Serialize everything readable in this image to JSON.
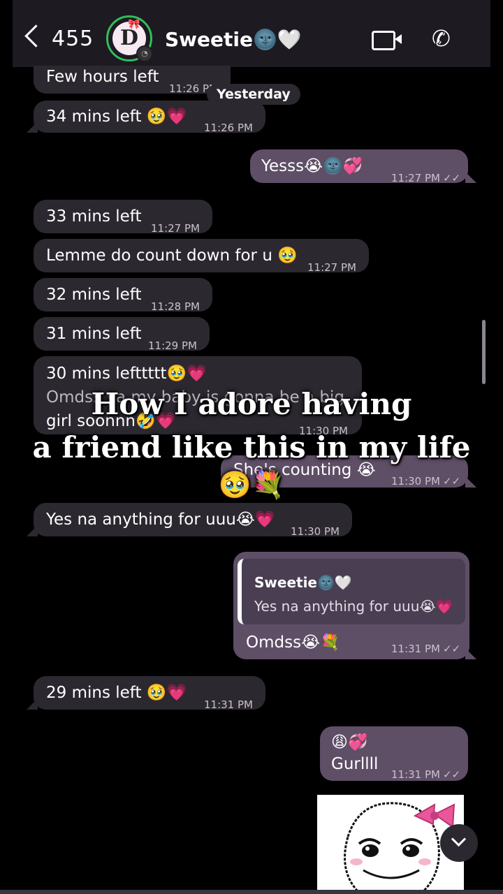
{
  "header": {
    "back_count": "455",
    "avatar_letter": "D",
    "contact_name": "Sweetie🌚🤍"
  },
  "day_separator": "Yesterday",
  "messages": [
    {
      "text": "Few hours left",
      "time": "11:26 PM",
      "dir": "in"
    },
    {
      "text": "34 mins left 🥹💗",
      "time": "11:26 PM",
      "dir": "in"
    },
    {
      "text": "Yesss😭🌚💞",
      "time": "11:27 PM",
      "dir": "out"
    },
    {
      "text": "33 mins left",
      "time": "11:27 PM",
      "dir": "in"
    },
    {
      "text": "Lemme do count down for u 🥹",
      "time": "11:27 PM",
      "dir": "in"
    },
    {
      "text": "32 mins left",
      "time": "11:28 PM",
      "dir": "in"
    },
    {
      "text": "31 mins left",
      "time": "11:29 PM",
      "dir": "in"
    },
    {
      "text_line1": "30 mins lefttttt🥹💗",
      "text_line2": "Omdss ya my baby is gonna be a big",
      "text_line3": "girl soonnn🤣💗",
      "time": "11:30 PM",
      "dir": "in"
    },
    {
      "text": "She's counting 😭",
      "time": "11:30 PM",
      "dir": "out"
    },
    {
      "text": "Yes na anything for uuu😭💗",
      "time": "11:30 PM",
      "dir": "in"
    },
    {
      "quote_author": "Sweetie🌚🤍",
      "quote_text": "Yes na anything for uuu😭💗",
      "text": "Omdss😭💐",
      "time": "11:31 PM",
      "dir": "out"
    },
    {
      "text": "29 mins left 🥹💗",
      "time": "11:31 PM",
      "dir": "in"
    },
    {
      "text_line1": "😩💞",
      "text_line2": "Gurllll",
      "time": "11:31 PM",
      "dir": "out"
    }
  ],
  "ticks": "✓✓",
  "overlay_caption": {
    "line1": "How I adore having",
    "line2": "a friend like this in my life",
    "line3": "🥹💐"
  },
  "icons": {
    "back": "chevron-left-icon",
    "video": "video-call-icon",
    "phone": "phone-icon",
    "scroll_down": "chevron-down-icon"
  },
  "colors": {
    "incoming_bubble": "#2c2830",
    "outgoing_bubble": "#5e4e66",
    "avatar_ring": "#2fbf5b"
  }
}
